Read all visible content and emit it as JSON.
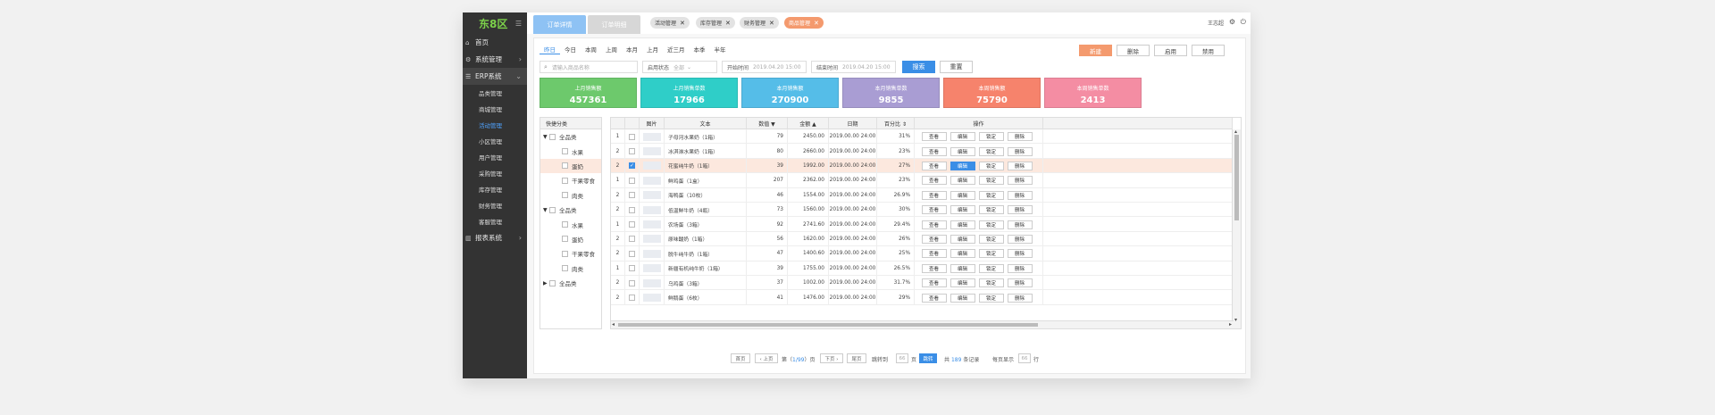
{
  "app": {
    "logo": "东8区"
  },
  "sidebar": {
    "items": [
      {
        "label": "首页",
        "icon": "home-icon",
        "glyph": "⌂"
      },
      {
        "label": "系统管理",
        "icon": "gear-icon",
        "glyph": "⚙",
        "chev": "›"
      },
      {
        "label": "ERP系统",
        "icon": "list-icon",
        "glyph": "☰",
        "chev": "⌄"
      }
    ],
    "sub_items": [
      "品类管理",
      "商城管理",
      "活动管理",
      "小区管理",
      "用户管理",
      "采购管理",
      "库存管理",
      "财务管理",
      "客服管理"
    ],
    "report": {
      "label": "报表系统",
      "icon": "chart-icon",
      "glyph": "▥",
      "chev": "›"
    }
  },
  "topbar": {
    "page_tabs": [
      "订单详情",
      "订单明细"
    ],
    "chips": [
      "活动管理",
      "库存管理",
      "财务管理",
      "商品管理"
    ],
    "user": "王志超"
  },
  "filters": {
    "time_tabs": [
      "昨日",
      "今日",
      "本周",
      "上周",
      "本月",
      "上月",
      "近三月",
      "本季",
      "半年"
    ],
    "search_placeholder": "请输入商品名称",
    "status_label": "启用状态",
    "status_value": "全部",
    "start_label": "开始时间",
    "start_value": "2019.04.20 15:00",
    "end_label": "结束时间",
    "end_value": "2019.04.20 15:00",
    "search_btn": "搜索",
    "reset_btn": "重置"
  },
  "actions": [
    "新建",
    "删除",
    "启用",
    "禁用"
  ],
  "stats": [
    {
      "label": "上月销售额",
      "value": "457361",
      "color": "#6dc96c"
    },
    {
      "label": "上月销售单数",
      "value": "17966",
      "color": "#2fcec8"
    },
    {
      "label": "本月销售额",
      "value": "270900",
      "color": "#55bde8"
    },
    {
      "label": "本月销售单数",
      "value": "9855",
      "color": "#a99dd3"
    },
    {
      "label": "本周销售额",
      "value": "75790",
      "color": "#f6836c"
    },
    {
      "label": "本周销售单数",
      "value": "2413",
      "color": "#f48da3"
    }
  ],
  "tree": {
    "header": "快捷分类",
    "nodes": [
      {
        "label": "全品类",
        "tri": "▼",
        "level": 0
      },
      {
        "label": "水果",
        "tri": "",
        "level": 1
      },
      {
        "label": "蛋奶",
        "tri": "",
        "level": 1,
        "selected": true
      },
      {
        "label": "干果零食",
        "tri": "",
        "level": 1
      },
      {
        "label": "肉类",
        "tri": "",
        "level": 1
      },
      {
        "label": "全品类",
        "tri": "▼",
        "level": 0
      },
      {
        "label": "水果",
        "tri": "",
        "level": 1
      },
      {
        "label": "蛋奶",
        "tri": "",
        "level": 1
      },
      {
        "label": "干果零食",
        "tri": "",
        "level": 1
      },
      {
        "label": "肉类",
        "tri": "",
        "level": 1
      },
      {
        "label": "全品类",
        "tri": "▶",
        "level": 0
      }
    ]
  },
  "table": {
    "columns": [
      {
        "label": "",
        "w": 16
      },
      {
        "label": "",
        "w": 16
      },
      {
        "label": "图片",
        "w": 28
      },
      {
        "label": "文本",
        "w": 92
      },
      {
        "label": "数值 ▼",
        "w": 46
      },
      {
        "label": "金额 ▲",
        "w": 46
      },
      {
        "label": "日期",
        "w": 54
      },
      {
        "label": "百分比 ⇕",
        "w": 42
      },
      {
        "label": "操作",
        "w": 144
      },
      {
        "label": "",
        "w": 212
      }
    ],
    "ops": [
      "查看",
      "编辑",
      "锁定",
      "删除"
    ],
    "rows": [
      {
        "idx": "1",
        "text": "子母河水果奶（1箱）",
        "num": "79",
        "amt": "2450.00",
        "date": "2019.00.00 24:00",
        "pct": "31%",
        "checked": false
      },
      {
        "idx": "2",
        "text": "冰淇淋水果奶（1箱）",
        "num": "80",
        "amt": "2660.00",
        "date": "2019.00.00 24:00",
        "pct": "23%",
        "checked": false
      },
      {
        "idx": "2",
        "text": "花蜜纯牛奶（1箱）",
        "num": "39",
        "amt": "1992.00",
        "date": "2019.00.00 24:00",
        "pct": "27%",
        "checked": true
      },
      {
        "idx": "1",
        "text": "鲜鸡蛋（1盒）",
        "num": "207",
        "amt": "2362.00",
        "date": "2019.00.00 24:00",
        "pct": "23%",
        "checked": false
      },
      {
        "idx": "2",
        "text": "海鸭蛋（10枚）",
        "num": "46",
        "amt": "1554.00",
        "date": "2019.00.00 24:00",
        "pct": "26.9%",
        "checked": false
      },
      {
        "idx": "2",
        "text": "低温鲜牛奶（4瓶）",
        "num": "73",
        "amt": "1560.00",
        "date": "2019.00.00 24:00",
        "pct": "30%",
        "checked": false
      },
      {
        "idx": "1",
        "text": "农场蛋（3箱）",
        "num": "92",
        "amt": "2741.60",
        "date": "2019.00.00 24:00",
        "pct": "29.4%",
        "checked": false
      },
      {
        "idx": "2",
        "text": "原味酸奶（1箱）",
        "num": "56",
        "amt": "1620.00",
        "date": "2019.00.00 24:00",
        "pct": "26%",
        "checked": false
      },
      {
        "idx": "2",
        "text": "脱牛纯牛奶（1箱）",
        "num": "47",
        "amt": "1400.60",
        "date": "2019.00.00 24:00",
        "pct": "25%",
        "checked": false
      },
      {
        "idx": "1",
        "text": "新疆有机纯牛奶（1箱）",
        "num": "39",
        "amt": "1755.00",
        "date": "2019.00.00 24:00",
        "pct": "26.5%",
        "checked": false
      },
      {
        "idx": "2",
        "text": "乌鸡蛋（3箱）",
        "num": "37",
        "amt": "1002.00",
        "date": "2019.00.00 24:00",
        "pct": "31.7%",
        "checked": false
      },
      {
        "idx": "2",
        "text": "鲜鹅蛋（6枚）",
        "num": "41",
        "amt": "1476.00",
        "date": "2019.00.00 24:00",
        "pct": "29%",
        "checked": false
      }
    ]
  },
  "pager": {
    "first": "首页",
    "prev": "‹ 上页",
    "page_pre": "第（",
    "page_cur": "1/99",
    "page_post": "）页",
    "next": "下页 ›",
    "last": "尾页",
    "jump_label": "跳转到",
    "jump_value": "66",
    "jump_unit": "页",
    "jump_btn": "跳转",
    "total_pre": "共",
    "total_num": "189",
    "total_post": "条记录",
    "per_label": "每页显示",
    "per_value": "66",
    "per_unit": "行"
  }
}
